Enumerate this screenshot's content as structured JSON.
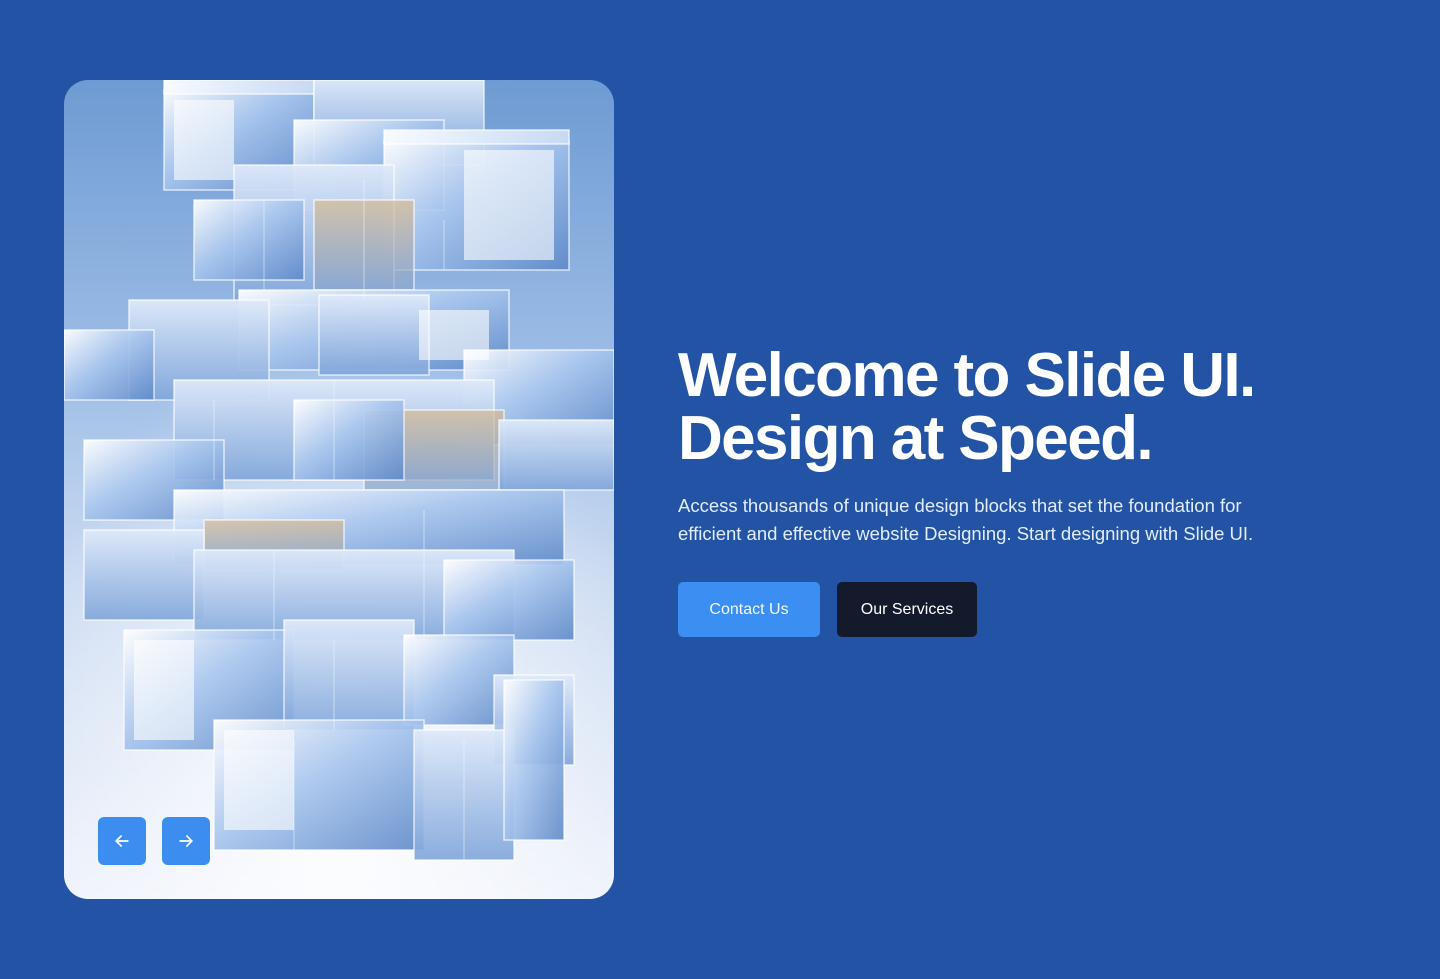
{
  "colors": {
    "page_background": "#2353a4",
    "primary_button": "#3b8ff2",
    "secondary_button": "#131a2b",
    "carousel_button": "#3b8df0",
    "text": "#ffffff"
  },
  "hero": {
    "headline_line1": "Welcome to Slide UI.",
    "headline_line2": "Design at Speed.",
    "description": "Access thousands of unique design blocks that set the foundation for efficient and effective website Designing. Start designing with Slide UI.",
    "primary_cta": "Contact Us",
    "secondary_cta": "Our Services"
  },
  "carousel": {
    "prev_icon": "arrow-left-icon",
    "next_icon": "arrow-right-icon"
  }
}
